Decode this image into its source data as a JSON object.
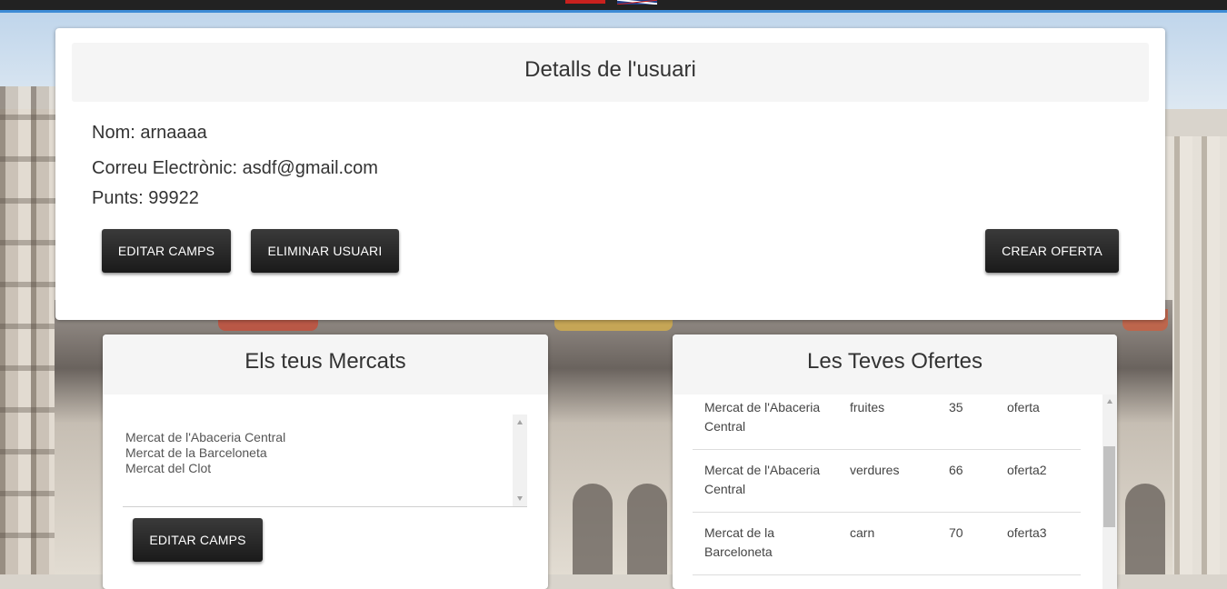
{
  "nav": {
    "flags": [
      "spanish-flag",
      "uk-flag"
    ]
  },
  "user_details": {
    "title": "Detalls de l'usuari",
    "name_line": "Nom: arnaaaa",
    "email_line": "Correu Electrònic: asdf@gmail.com",
    "points_line": "Punts: 99922",
    "buttons": {
      "edit": "EDITAR CAMPS",
      "delete": "ELIMINAR USUARI",
      "create_offer": "CREAR OFERTA"
    }
  },
  "markets": {
    "title": "Els teus Mercats",
    "items": [
      "Mercat de l'Abaceria Central",
      "Mercat de la Barceloneta",
      "Mercat del Clot"
    ],
    "edit_button": "EDITAR CAMPS"
  },
  "offers": {
    "title": "Les Teves Ofertes",
    "rows": [
      {
        "market": "Mercat de l'Abaceria Central",
        "category": "fruites",
        "points": "35",
        "name": "oferta"
      },
      {
        "market": "Mercat de l'Abaceria Central",
        "category": "verdures",
        "points": "66",
        "name": "oferta2"
      },
      {
        "market": "Mercat de la Barceloneta",
        "category": "carn",
        "points": "70",
        "name": "oferta3"
      }
    ]
  },
  "colors": {
    "button_bg": "#222222",
    "nav_bg": "#222222",
    "panel_header_bg": "#f5f5f5"
  }
}
